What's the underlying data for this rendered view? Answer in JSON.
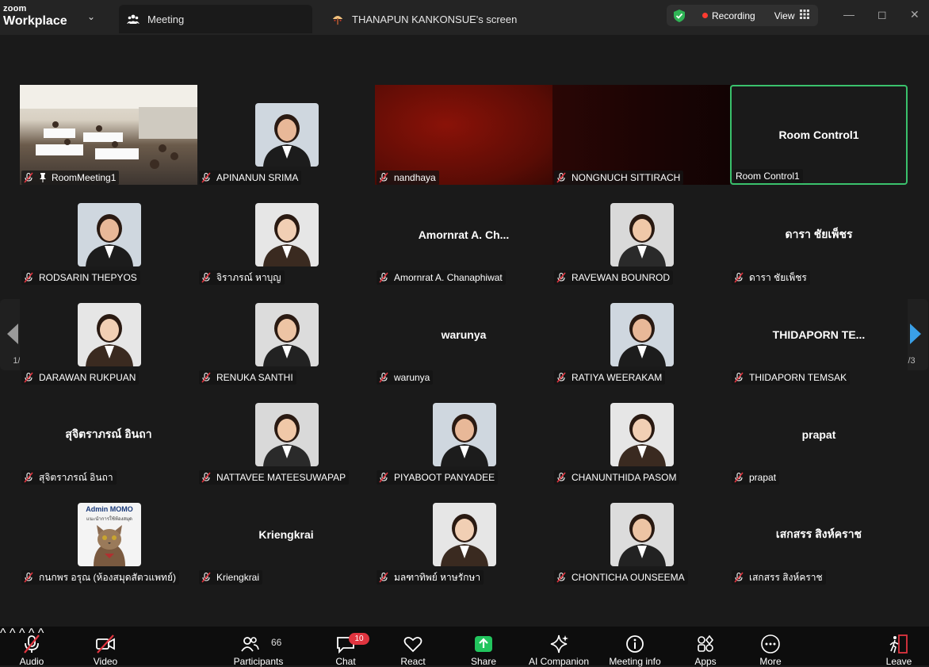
{
  "app": {
    "brand_top": "zoom",
    "brand_bottom": "Workplace"
  },
  "tabs": [
    {
      "label": "Meeting",
      "icon": "participants-icon"
    },
    {
      "label": "THANAPUN KANKONSUE's screen",
      "icon": "screen-share-icon"
    }
  ],
  "status": {
    "recording": "Recording",
    "view": "View"
  },
  "page_indicator": {
    "left": "1/3",
    "right": "1/3"
  },
  "participants": [
    {
      "name": "RoomMeeting1",
      "type": "video",
      "pinned": true
    },
    {
      "name": "APINANUN SRIMA",
      "type": "photo"
    },
    {
      "name": "nandhaya",
      "type": "video-red"
    },
    {
      "name": "NONGNUCH SITTIRACH",
      "type": "video-dark"
    },
    {
      "name": "Room Control1",
      "big": "Room Control1",
      "type": "name",
      "active": true
    },
    {
      "name": "RODSARIN THEPYOS",
      "type": "photo"
    },
    {
      "name": "จิราภรณ์  หาบุญ",
      "type": "photo"
    },
    {
      "name": "Amornrat A. Chanaphiwat",
      "big": "Amornrat A. Ch...",
      "type": "name"
    },
    {
      "name": "RAVEWAN BOUNROD",
      "type": "photo"
    },
    {
      "name": "ดารา ชัยเพ็ชร",
      "big": "ดารา ชัยเพ็ชร",
      "type": "name"
    },
    {
      "name": "DARAWAN RUKPUAN",
      "type": "photo"
    },
    {
      "name": "RENUKA SANTHI",
      "type": "photo"
    },
    {
      "name": "warunya",
      "big": "warunya",
      "type": "name"
    },
    {
      "name": "RATIYA WEERAKAM",
      "type": "photo"
    },
    {
      "name": "THIDAPORN TEMSAK",
      "big": "THIDAPORN TE...",
      "type": "name"
    },
    {
      "name": "สุจิตราภรณ์ อินถา",
      "big": "สุจิตราภรณ์ อินถา",
      "type": "name"
    },
    {
      "name": "NATTAVEE MATEESUWAPAP",
      "type": "photo"
    },
    {
      "name": "PIYABOOT PANYADEE",
      "type": "photo"
    },
    {
      "name": "CHANUNTHIDA PASOM",
      "type": "photo"
    },
    {
      "name": "prapat",
      "big": "prapat",
      "type": "name"
    },
    {
      "name": "กนกพร  อรุณ (ห้องสมุดสัตวแพทย์)",
      "type": "admin",
      "admin_title": "Admin MOMO",
      "admin_sub": "แนะนำการใช้ห้องสมุด"
    },
    {
      "name": "Kriengkrai",
      "big": "Kriengkrai",
      "type": "name"
    },
    {
      "name": "มลฑาทิพย์ หาษรักษา",
      "type": "photo"
    },
    {
      "name": "CHONTICHA OUNSEEMA",
      "type": "photo"
    },
    {
      "name": "เสกสรร สิงห์คราช",
      "big": "เสกสรร สิงห์คราช",
      "type": "name"
    }
  ],
  "toolbar": {
    "audio": "Audio",
    "video": "Video",
    "participants": "Participants",
    "participants_count": "66",
    "chat": "Chat",
    "chat_badge": "10",
    "react": "React",
    "share": "Share",
    "ai": "AI Companion",
    "info": "Meeting info",
    "apps": "Apps",
    "more": "More",
    "leave": "Leave"
  },
  "colors": {
    "accent_green": "#3ac16c",
    "share_green": "#22c55e",
    "record_red": "#ff3b30",
    "badge_red": "#e0343f",
    "nav_arrow": "#3aa0e8"
  }
}
